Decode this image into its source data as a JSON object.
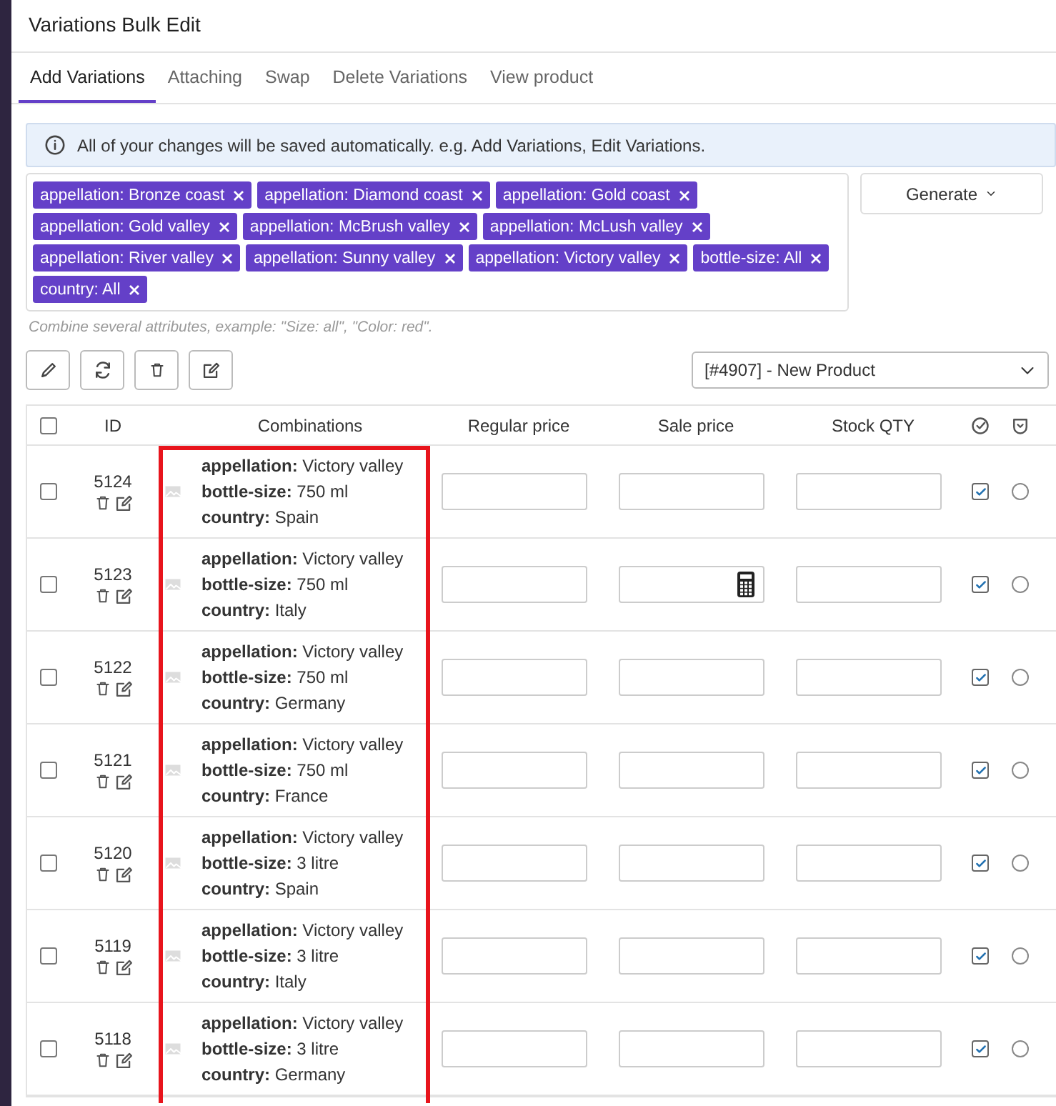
{
  "window": {
    "title": "Variations Bulk Edit"
  },
  "tabs": [
    {
      "label": "Add Variations",
      "selected": true
    },
    {
      "label": "Attaching",
      "selected": false
    },
    {
      "label": "Swap",
      "selected": false
    },
    {
      "label": "Delete Variations",
      "selected": false
    },
    {
      "label": "View product",
      "selected": false
    }
  ],
  "notice": "All of your changes will be saved automatically. e.g. Add Variations, Edit Variations.",
  "attribute_tags": [
    "appellation: Bronze coast",
    "appellation: Diamond coast",
    "appellation: Gold coast",
    "appellation: Gold valley",
    "appellation: McBrush valley",
    "appellation: McLush valley",
    "appellation: River valley",
    "appellation: Sunny valley",
    "appellation: Victory valley",
    "bottle-size: All",
    "country: All"
  ],
  "generate_button": "Generate",
  "hint": "Combine several attributes, example: \"Size: all\", \"Color: red\".",
  "product_select": {
    "value": "[#4907] - New Product"
  },
  "table": {
    "columns": [
      "ID",
      "Combinations",
      "Regular price",
      "Sale price",
      "Stock QTY"
    ],
    "all_selected": false,
    "rows": [
      {
        "id": "5124",
        "selected": false,
        "enabled": true,
        "default": false,
        "calculator": false,
        "attributes": [
          "**appellation:** Victory valley",
          "**bottle-size:** 750 ml",
          "**country:** Spain"
        ]
      },
      {
        "id": "5123",
        "selected": false,
        "enabled": true,
        "default": false,
        "calculator": true,
        "attributes": [
          "**appellation:** Victory valley",
          "**bottle-size:** 750 ml",
          "**country:** Italy"
        ]
      },
      {
        "id": "5122",
        "selected": false,
        "enabled": true,
        "default": false,
        "calculator": false,
        "attributes": [
          "**appellation:** Victory valley",
          "**bottle-size:** 750 ml",
          "**country:** Germany"
        ]
      },
      {
        "id": "5121",
        "selected": false,
        "enabled": true,
        "default": false,
        "calculator": false,
        "attributes": [
          "**appellation:** Victory valley",
          "**bottle-size:** 750 ml",
          "**country:** France"
        ]
      },
      {
        "id": "5120",
        "selected": false,
        "enabled": true,
        "default": false,
        "calculator": false,
        "attributes": [
          "**appellation:** Victory valley",
          "**bottle-size:** 3 litre",
          "**country:** Spain"
        ]
      },
      {
        "id": "5119",
        "selected": false,
        "enabled": true,
        "default": false,
        "calculator": false,
        "attributes": [
          "**appellation:** Victory valley",
          "**bottle-size:** 3 litre",
          "**country:** Italy"
        ]
      },
      {
        "id": "5118",
        "selected": false,
        "enabled": true,
        "default": false,
        "calculator": false,
        "attributes": [
          "**appellation:** Victory valley",
          "**bottle-size:** 3 litre",
          "**country:** Germany"
        ]
      }
    ]
  }
}
